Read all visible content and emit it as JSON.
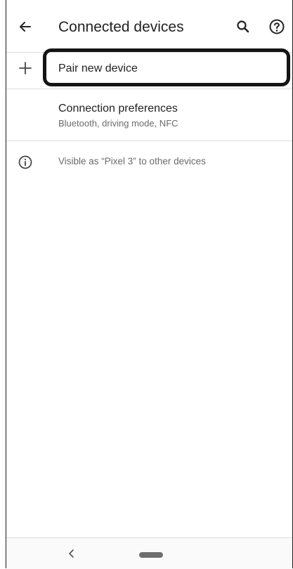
{
  "appbar": {
    "title": "Connected devices",
    "back_icon": "arrow-left-icon",
    "search_icon": "search-icon",
    "help_icon": "help-circle-icon"
  },
  "items": {
    "pair": {
      "label": "Pair new device",
      "icon": "plus-icon"
    },
    "preferences": {
      "title": "Connection preferences",
      "subtitle": "Bluetooth, driving mode, NFC"
    }
  },
  "info": {
    "text": "Visible as “Pixel 3” to other devices",
    "icon": "info-icon"
  },
  "navbar": {
    "back_icon": "nav-back-chevron-icon",
    "home_icon": "home-pill-icon"
  }
}
